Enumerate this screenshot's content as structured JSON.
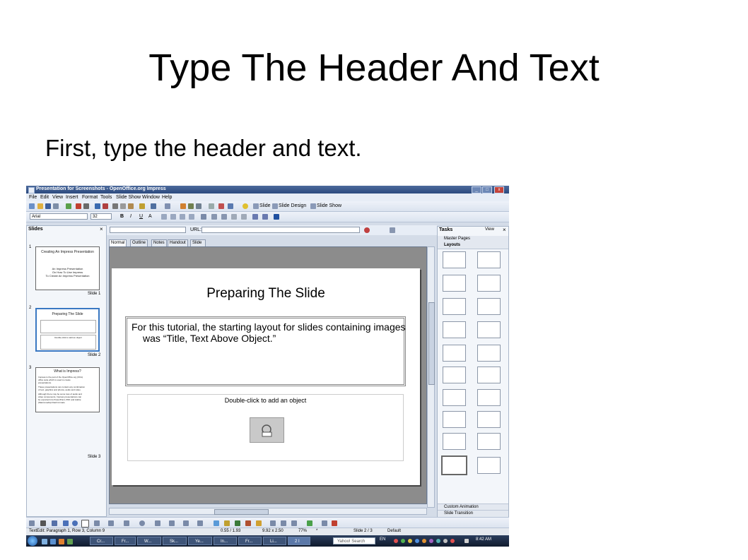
{
  "slide": {
    "title": "Type The Header And Text",
    "body": "First, type the header and text."
  },
  "screenshot": {
    "window_title": "Presentation for Screenshots - OpenOffice.org Impress",
    "window_buttons": [
      "_",
      "□",
      "x"
    ],
    "menus": [
      "File",
      "Edit",
      "View",
      "Insert",
      "Format",
      "Tools",
      "Slide Show",
      "Window",
      "Help"
    ],
    "toolbar": {
      "slide_label": "Slide",
      "slide_design_label": "Slide Design",
      "slide_show_label": "Slide Show"
    },
    "format_bar": {
      "font_name": "Arial",
      "font_size": "32",
      "bold": "B",
      "italic": "I",
      "underline": "U",
      "shadow": "A"
    },
    "url_label": "URL:",
    "slides_pane": {
      "title": "Slides",
      "close": "×",
      "thumbs": [
        {
          "num": "1",
          "label": "Slide 1",
          "title": "Creating An Impress Presentation",
          "lines": [
            "An Impress Presentation",
            "On How To Use Impress",
            "To Create An Impress Presentation"
          ]
        },
        {
          "num": "2",
          "label": "Slide 2",
          "title": "Preparing The Slide",
          "lines": [
            "Double-click to add an object"
          ]
        },
        {
          "num": "3",
          "label": "Slide 3",
          "title": "What is Impress?",
          "lines": [
            "Impress is the part of the OpenOffice.org (OOo)",
            "office suite which is used to create",
            "presentations.",
            "These presentations can contain any combination",
            "of text, graphics and photos, audio and video.",
            "Although there may be some loss of audio and",
            "video components, Impress presentations can",
            "be exported into PowerPoint, PDF and Adobe",
            "(Macromedia) Flash formats."
          ]
        }
      ]
    },
    "view_tabs": [
      "Normal",
      "Outline",
      "Notes",
      "Handout",
      "Slide Sorter"
    ],
    "canvas": {
      "title": "Preparing The Slide",
      "text": "For this tutorial, the starting layout for slides containing images was “Title, Text Above Object.”",
      "object_hint": "Double-click to add an object"
    },
    "tasks_pane": {
      "title": "Tasks",
      "view_label": "View",
      "close": "×",
      "master_pages": "Master Pages",
      "layouts": "Layouts",
      "custom_animation": "Custom Animation",
      "slide_transition": "Slide Transition"
    },
    "status_bar": {
      "edit": "TextEdit: Paragraph 1, Row 3, Column 9",
      "position": "0.55 / 1.93",
      "size": "9.92 x 2.50",
      "zoom": "77%",
      "modified": "*",
      "slide": "Slide 2 / 3",
      "master": "Default"
    },
    "taskbar": {
      "tasks": [
        "Cr...",
        "Fr...",
        "W...",
        "Sk...",
        "Ye...",
        "In...",
        "Fr...",
        "Li...",
        "2 I"
      ],
      "search_placeholder": "Yahoo! Search",
      "lang": "EN",
      "clock": "8:42 AM"
    }
  }
}
